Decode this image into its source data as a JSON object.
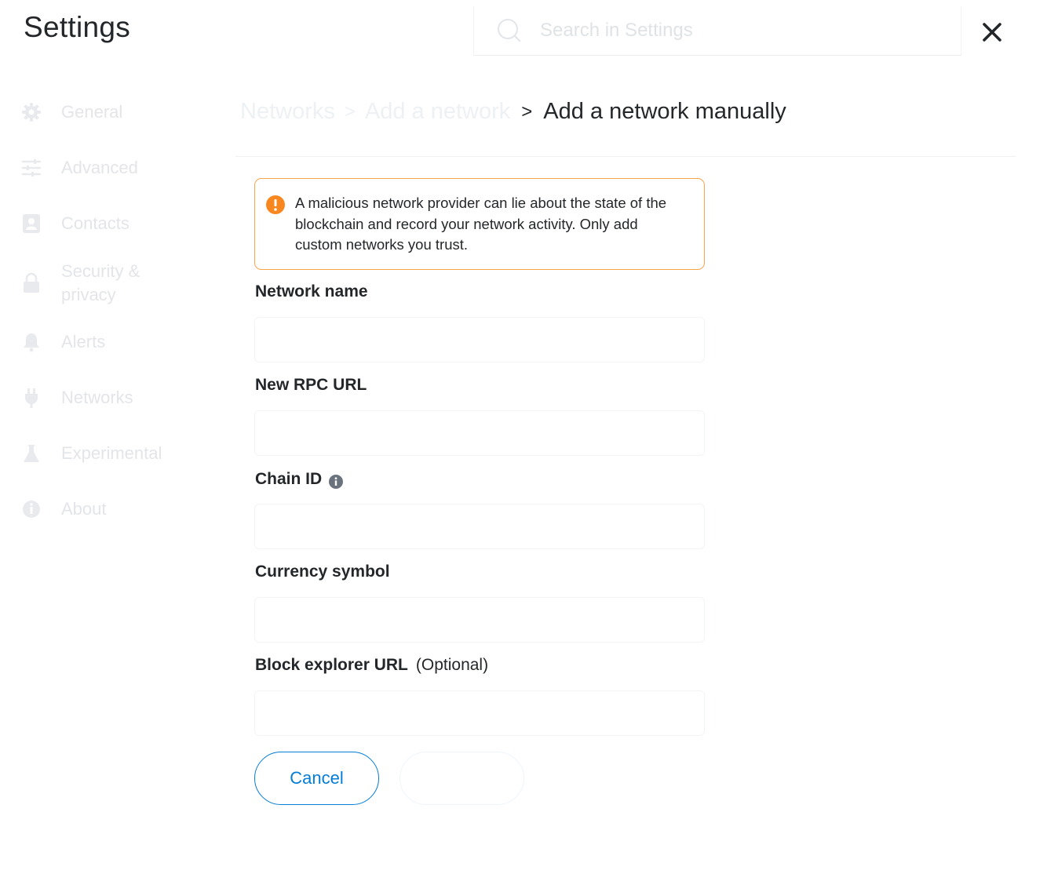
{
  "header": {
    "title": "Settings",
    "search_placeholder": "Search in Settings"
  },
  "icons": {
    "search": "search-icon",
    "close": "close-icon",
    "warning": "info-circle-icon",
    "chain_info": "info-icon"
  },
  "sidebar": {
    "items": [
      {
        "label": "General",
        "icon": "gear-icon"
      },
      {
        "label": "Advanced",
        "icon": "sliders-icon"
      },
      {
        "label": "Contacts",
        "icon": "contact-book-icon"
      },
      {
        "label": "Security & privacy",
        "icon": "lock-icon"
      },
      {
        "label": "Alerts",
        "icon": "bell-icon"
      },
      {
        "label": "Networks",
        "icon": "plug-icon"
      },
      {
        "label": "Experimental",
        "icon": "flask-icon"
      },
      {
        "label": "About",
        "icon": "info-icon"
      }
    ]
  },
  "breadcrumb": {
    "items": [
      "Networks",
      "Add a network"
    ],
    "separator": ">",
    "current": "Add a network manually"
  },
  "warning": {
    "text": "A malicious network provider can lie about the state of the blockchain and record your network activity. Only add custom networks you trust."
  },
  "form": {
    "network_name": {
      "label": "Network name",
      "value": ""
    },
    "rpc_url": {
      "label": "New RPC URL",
      "value": ""
    },
    "chain_id": {
      "label": "Chain ID",
      "value": ""
    },
    "currency_symbol": {
      "label": "Currency symbol",
      "value": ""
    },
    "block_explorer": {
      "label": "Block explorer URL",
      "optional": "(Optional)",
      "value": ""
    }
  },
  "buttons": {
    "cancel": "Cancel",
    "save": ""
  },
  "colors": {
    "primary": "#037dd6",
    "warning_border": "#f6a54a",
    "warning_icon": "#f8871f",
    "text": "#24272a",
    "sidebar_text": "#e3e5e8"
  }
}
